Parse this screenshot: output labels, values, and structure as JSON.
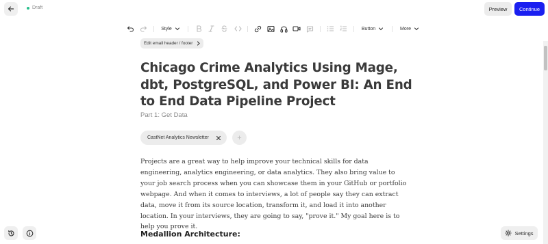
{
  "header": {
    "status_label": "Draft",
    "status_color": "#28c08c",
    "preview_label": "Preview",
    "continue_label": "Continue",
    "accent_color": "#1a1ff0"
  },
  "toolbar": {
    "style_label": "Style",
    "button_label": "Button",
    "more_label": "More",
    "icons": [
      "undo-icon",
      "redo-icon",
      "bold-icon",
      "italic-icon",
      "strikethrough-icon",
      "code-icon",
      "link-icon",
      "image-icon",
      "audio-icon",
      "video-icon",
      "comment-icon",
      "bullet-list-icon",
      "numbered-list-icon"
    ]
  },
  "editor": {
    "edit_header_label": "Edit email header / footer",
    "title": "Chicago Crime Analytics Using Mage, dbt, PostgreSQL, and Power BI: An End to End Data Pipeline Project",
    "subtitle": "Part 1: Get Data",
    "tag": "CastNet Analytics Newsletter",
    "add_tag_symbol": "+",
    "body": "Projects are a great way to help improve your technical skills for data engineering, analytics engineering, or data analytics. They also bring value to your job search process when you can showcase them in your GitHub or portfolio webpage. And when it comes to interviews, a lot of people say they can extract data, move it from its source location, transform it, and load it into another location. In your interviews, they are going to say, \"prove it.\" My goal here is to help you prove it.",
    "section_heading": "Medallion Architecture:"
  },
  "footer": {
    "settings_label": "Settings"
  }
}
